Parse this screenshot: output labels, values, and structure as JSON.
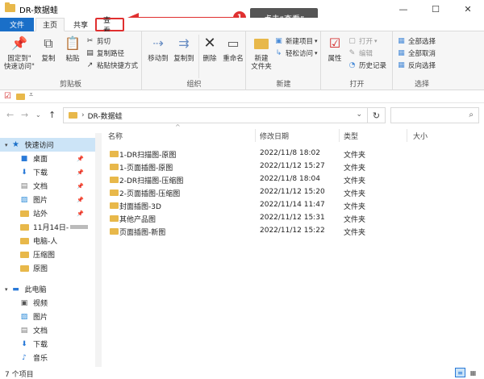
{
  "window": {
    "title": "DR-数据蛙",
    "minimize": "—",
    "maximize": "☐",
    "close": "✕"
  },
  "tabs": [
    {
      "label": "文件"
    },
    {
      "label": "主页"
    },
    {
      "label": "共享"
    },
    {
      "label": "查看"
    }
  ],
  "ribbon": {
    "clipboard": {
      "group_label": "剪贴板",
      "pin_quick_access": "固定到\"\n快速访问\"",
      "copy": "复制",
      "paste": "粘贴",
      "cut": "剪切",
      "copy_path": "复制路径",
      "paste_shortcut": "粘贴快捷方式"
    },
    "organize": {
      "group_label": "组织",
      "move_to": "移动到",
      "copy_to": "复制到",
      "delete": "删除",
      "rename": "重命名"
    },
    "new": {
      "group_label": "新建",
      "new_folder": "新建\n文件夹",
      "new_item": "新建项目",
      "easy_access": "轻松访问"
    },
    "open": {
      "group_label": "打开",
      "properties": "属性",
      "open": "打开",
      "edit": "编辑",
      "history": "历史记录"
    },
    "select": {
      "group_label": "选择",
      "select_all": "全部选择",
      "select_none": "全部取消",
      "invert": "反向选择"
    }
  },
  "address": {
    "path": "DR-数据蛙",
    "search_placeholder": ""
  },
  "columns": {
    "name": "名称",
    "modified": "修改日期",
    "type": "类型",
    "size": "大小"
  },
  "files": [
    {
      "name": "1-DR扫描图-原图",
      "modified": "2022/11/8 18:02",
      "type": "文件夹"
    },
    {
      "name": "1-页面插图-原图",
      "modified": "2022/11/12 15:27",
      "type": "文件夹"
    },
    {
      "name": "2-DR扫描图-压缩图",
      "modified": "2022/11/8 18:04",
      "type": "文件夹"
    },
    {
      "name": "2-页面插图-压缩图",
      "modified": "2022/11/12 15:20",
      "type": "文件夹"
    },
    {
      "name": "封面插图-3D",
      "modified": "2022/11/14 11:47",
      "type": "文件夹"
    },
    {
      "name": "其他产品图",
      "modified": "2022/11/12 15:31",
      "type": "文件夹"
    },
    {
      "name": "页面插图-新图",
      "modified": "2022/11/12 15:22",
      "type": "文件夹"
    }
  ],
  "nav": [
    {
      "label": "快速访问"
    },
    {
      "label": "桌面"
    },
    {
      "label": "下载"
    },
    {
      "label": "文档"
    },
    {
      "label": "图片"
    },
    {
      "label": "站外"
    },
    {
      "label": "11月14日-"
    },
    {
      "label": "电脑-人"
    },
    {
      "label": "压缩图"
    },
    {
      "label": "原图"
    },
    {
      "label": "此电脑"
    },
    {
      "label": "视频"
    },
    {
      "label": "图片"
    },
    {
      "label": "文档"
    },
    {
      "label": "下载"
    },
    {
      "label": "音乐"
    }
  ],
  "status": {
    "count": "7 个项目"
  },
  "annotation": {
    "step": "1",
    "text": "点击“查看”"
  },
  "colors": {
    "accent": "#1a6fc8",
    "annotation": "#e03030",
    "folder": "#e8b84a"
  }
}
